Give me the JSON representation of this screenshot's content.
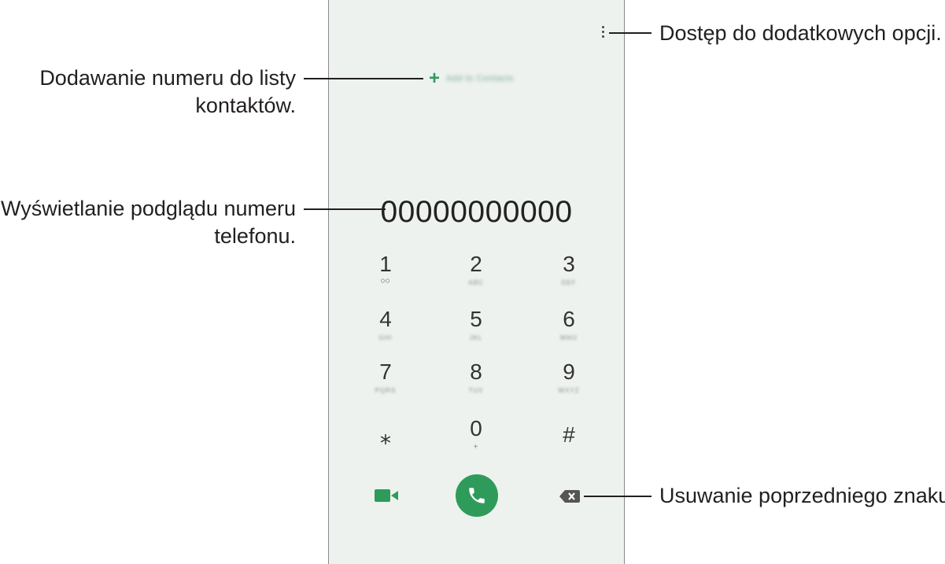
{
  "dialer": {
    "add_to_contacts_label": "Add to Contacts",
    "number": "00000000000",
    "keys": [
      {
        "digit": "1",
        "sub": "ᴼᴼ"
      },
      {
        "digit": "2",
        "sub": "ABC"
      },
      {
        "digit": "3",
        "sub": "DEF"
      },
      {
        "digit": "4",
        "sub": "GHI"
      },
      {
        "digit": "5",
        "sub": "JKL"
      },
      {
        "digit": "6",
        "sub": "MNO"
      },
      {
        "digit": "7",
        "sub": "PQRS"
      },
      {
        "digit": "8",
        "sub": "TUV"
      },
      {
        "digit": "9",
        "sub": "WXYZ"
      },
      {
        "digit": "⁎",
        "sub": ""
      },
      {
        "digit": "0",
        "sub": "+"
      },
      {
        "digit": "#",
        "sub": ""
      }
    ],
    "icons": {
      "menu": "more-options-icon",
      "add": "plus-icon",
      "video": "video-call-icon",
      "call": "phone-icon",
      "backspace": "backspace-icon"
    },
    "accent_color": "#2f9b5b"
  },
  "callouts": {
    "more_options": "Dostęp do dodatkowych opcji.",
    "add_contact_line1": "Dodawanie numeru do listy",
    "add_contact_line2": "kontaktów.",
    "preview_line1": "Wyświetlanie podglądu numeru",
    "preview_line2": "telefonu.",
    "delete_char": "Usuwanie poprzedniego znaku."
  }
}
